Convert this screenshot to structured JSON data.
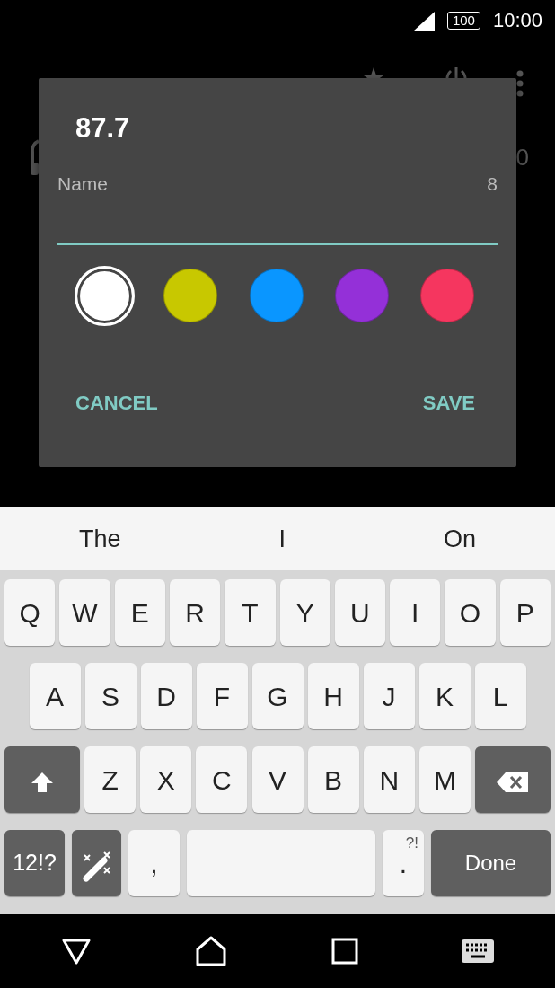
{
  "status_bar": {
    "battery": "100",
    "time": "10:00"
  },
  "background": {
    "partial_text": "0"
  },
  "dialog": {
    "title": "87.7",
    "field_label": "Name",
    "counter": "8",
    "colors": [
      {
        "color": "#ffffff",
        "selected": true
      },
      {
        "color": "#c8c800",
        "selected": false
      },
      {
        "color": "#0a96ff",
        "selected": false
      },
      {
        "color": "#9430d8",
        "selected": false
      },
      {
        "color": "#f5365f",
        "selected": false
      }
    ],
    "buttons": [
      "CANCEL",
      "SAVE"
    ]
  },
  "suggestions": [
    "The",
    "I",
    "On"
  ],
  "keyboard": [
    [
      {
        "kind": "letter",
        "label": "Q"
      },
      {
        "kind": "letter",
        "label": "W"
      },
      {
        "kind": "letter",
        "label": "E"
      },
      {
        "kind": "letter",
        "label": "R"
      },
      {
        "kind": "letter",
        "label": "T"
      },
      {
        "kind": "letter",
        "label": "Y"
      },
      {
        "kind": "letter",
        "label": "U"
      },
      {
        "kind": "letter",
        "label": "I"
      },
      {
        "kind": "letter",
        "label": "O"
      },
      {
        "kind": "letter",
        "label": "P"
      }
    ],
    [
      {
        "kind": "letter",
        "label": "A"
      },
      {
        "kind": "letter",
        "label": "S"
      },
      {
        "kind": "letter",
        "label": "D"
      },
      {
        "kind": "letter",
        "label": "F"
      },
      {
        "kind": "letter",
        "label": "G"
      },
      {
        "kind": "letter",
        "label": "H"
      },
      {
        "kind": "letter",
        "label": "J"
      },
      {
        "kind": "letter",
        "label": "K"
      },
      {
        "kind": "letter",
        "label": "L"
      }
    ],
    [
      {
        "kind": "shift"
      },
      {
        "kind": "letter",
        "label": "Z"
      },
      {
        "kind": "letter",
        "label": "X"
      },
      {
        "kind": "letter",
        "label": "C"
      },
      {
        "kind": "letter",
        "label": "V"
      },
      {
        "kind": "letter",
        "label": "B"
      },
      {
        "kind": "letter",
        "label": "N"
      },
      {
        "kind": "letter",
        "label": "M"
      },
      {
        "kind": "backspace"
      }
    ],
    [
      {
        "kind": "symbols",
        "label": "12!?"
      },
      {
        "kind": "magic"
      },
      {
        "kind": "letter",
        "label": ","
      },
      {
        "kind": "space"
      },
      {
        "kind": "period",
        "label": ".",
        "hint": "?!"
      },
      {
        "kind": "done",
        "label": "Done"
      }
    ]
  ]
}
